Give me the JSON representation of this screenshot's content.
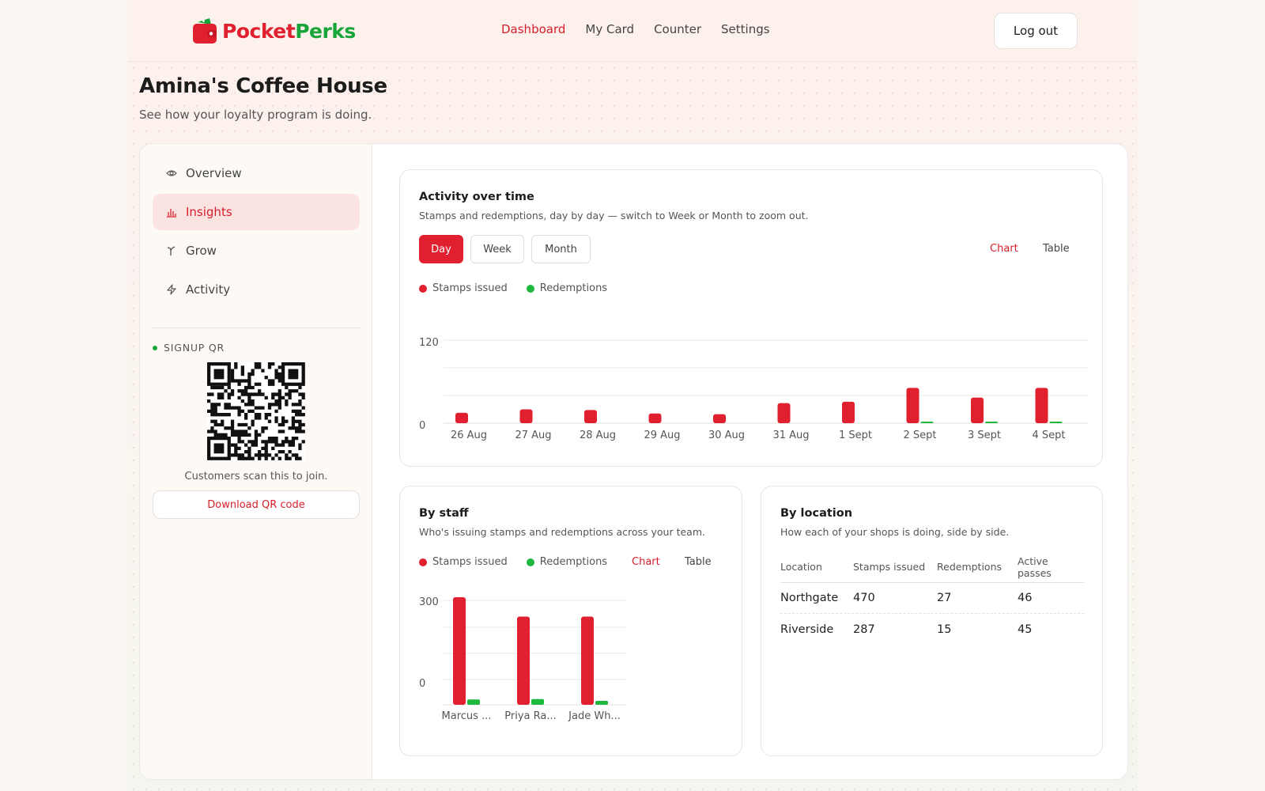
{
  "brand": {
    "name_part1": "Pocket",
    "name_part2": "Perks"
  },
  "nav": {
    "links": [
      {
        "label": "Dashboard",
        "active": true
      },
      {
        "label": "My Card",
        "active": false
      },
      {
        "label": "Counter",
        "active": false
      },
      {
        "label": "Settings",
        "active": false
      }
    ],
    "logout_label": "Log out"
  },
  "header": {
    "title": "Amina's Coffee House",
    "subtitle": "See how your loyalty program is doing."
  },
  "sidebar": {
    "items": [
      {
        "label": "Overview",
        "icon": "eye-icon",
        "active": false
      },
      {
        "label": "Insights",
        "icon": "bar-chart-icon",
        "active": true
      },
      {
        "label": "Grow",
        "icon": "sprout-icon",
        "active": false
      },
      {
        "label": "Activity",
        "icon": "lightning-icon",
        "active": false
      }
    ],
    "qr": {
      "label": "SIGNUP QR",
      "caption": "Customers scan this to join.",
      "download_label": "Download QR code"
    }
  },
  "activity": {
    "title": "Activity over time",
    "subtitle": "Stamps and redemptions, day by day — switch to Week or Month to zoom out.",
    "ranges": [
      {
        "label": "Day",
        "active": true
      },
      {
        "label": "Week",
        "active": false
      },
      {
        "label": "Month",
        "active": false
      }
    ],
    "views": [
      {
        "label": "Chart",
        "active": true
      },
      {
        "label": "Table",
        "active": false
      }
    ],
    "legend": {
      "stamps": "Stamps issued",
      "redemptions": "Redemptions"
    }
  },
  "staff": {
    "title": "By staff",
    "subtitle": "Who's issuing stamps and redemptions across your team.",
    "legend": {
      "stamps": "Stamps issued",
      "redemptions": "Redemptions"
    },
    "views": [
      {
        "label": "Chart",
        "active": true
      },
      {
        "label": "Table",
        "active": false
      }
    ]
  },
  "location": {
    "title": "By location",
    "subtitle": "How each of your shops is doing, side by side.",
    "headers": [
      "Location",
      "Stamps issued",
      "Redemptions",
      "Active passes"
    ],
    "rows": [
      {
        "location": "Northgate",
        "stamps": "470",
        "redemptions": "27",
        "active": "46"
      },
      {
        "location": "Riverside",
        "stamps": "287",
        "redemptions": "15",
        "active": "45"
      }
    ]
  },
  "colors": {
    "stamps": "#e01f2f",
    "redemptions": "#1fb83f",
    "accent": "#d81e2c",
    "brand_green": "#17a53a"
  },
  "chart_data": [
    {
      "type": "bar",
      "categories": [
        "26 Aug",
        "27 Aug",
        "28 Aug",
        "29 Aug",
        "30 Aug",
        "31 Aug",
        "1 Sept",
        "2 Sept",
        "3 Sept",
        "4 Sept"
      ],
      "series": [
        {
          "name": "Stamps issued",
          "values": [
            15,
            20,
            19,
            14,
            13,
            29,
            31,
            51,
            37,
            51
          ]
        },
        {
          "name": "Redemptions",
          "values": [
            0,
            0,
            0,
            0,
            0,
            0,
            0,
            2,
            2,
            2
          ]
        }
      ],
      "y_ticks": [
        "120",
        "0"
      ],
      "ylim": [
        0,
        120
      ],
      "legend": "top-left",
      "grid": true
    },
    {
      "type": "bar",
      "categories": [
        "Marcus ...",
        "Priya Ra...",
        "Jade Wh..."
      ],
      "series": [
        {
          "name": "Stamps issued",
          "values": [
            300,
            246,
            246
          ]
        },
        {
          "name": "Redemptions",
          "values": [
            15,
            16,
            11
          ]
        }
      ],
      "y_ticks": [
        "300",
        "0"
      ],
      "ylim": [
        0,
        300
      ],
      "legend": "top-left",
      "grid": true
    }
  ]
}
